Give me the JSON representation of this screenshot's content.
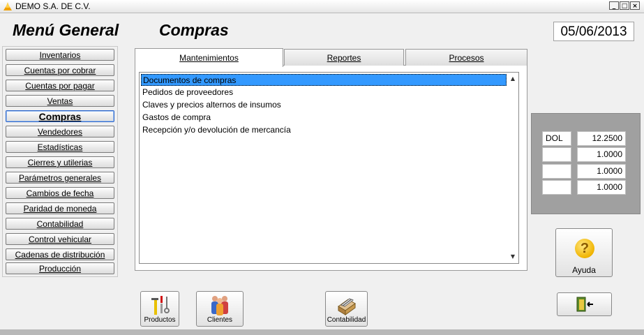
{
  "window": {
    "title": "DEMO  S.A. DE C.V."
  },
  "header": {
    "menu_title": "Menú General",
    "section_title": "Compras",
    "date": "05/06/2013"
  },
  "menu": {
    "items": [
      "Inventarios",
      "Cuentas por cobrar",
      "Cuentas por pagar",
      "Ventas",
      "Compras",
      "Vendedores",
      "Estadísticas",
      "Cierres y utilerias",
      "Parámetros generales",
      "Cambios de fecha",
      "Paridad de moneda",
      "Contabilidad",
      "Control vehicular",
      "Cadenas de distribución",
      "Producción"
    ],
    "active": "Compras"
  },
  "tabs": [
    {
      "label": "Mantenimientos"
    },
    {
      "label": "Reportes"
    },
    {
      "label": "Procesos"
    }
  ],
  "list": {
    "items": [
      "Documentos de compras",
      "Pedidos de proveedores",
      "Claves y precios alternos de insumos",
      "Gastos de compra",
      "Recepción y/o devolución de mercancía"
    ],
    "selected": "Documentos de compras"
  },
  "currency": {
    "rows": [
      {
        "code": "DOL",
        "rate": "12.2500"
      },
      {
        "code": "",
        "rate": "1.0000"
      },
      {
        "code": "",
        "rate": "1.0000"
      },
      {
        "code": "",
        "rate": "1.0000"
      }
    ]
  },
  "buttons": {
    "help": "Ayuda",
    "productos": "Productos",
    "clientes": "Clientes",
    "contabilidad": "Contabilidad"
  },
  "colors": {
    "selection": "#3399ff",
    "panel": "#a0a0a0",
    "background": "#f0f0f0"
  }
}
